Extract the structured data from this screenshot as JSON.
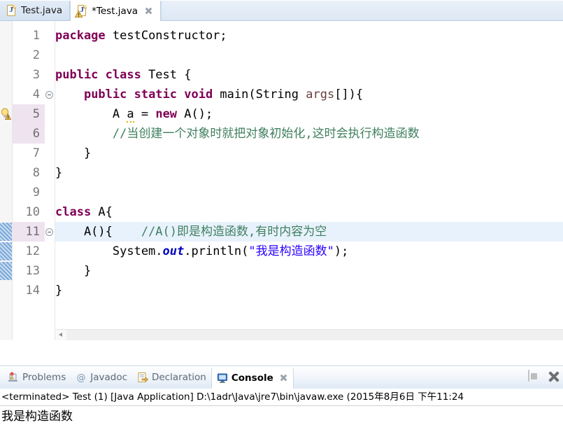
{
  "editor": {
    "tabs": [
      {
        "label": "Test.java",
        "icon": "java-file-icon",
        "active": false,
        "dirty": false,
        "has_warning": false,
        "closable": false
      },
      {
        "label": "*Test.java",
        "icon": "java-file-warning-icon",
        "active": true,
        "dirty": true,
        "has_warning": true,
        "closable": true
      }
    ],
    "close_icon": "close-icon",
    "lines": [
      {
        "num": "1",
        "fold": false,
        "marker": "none",
        "cursor": false,
        "num_hl": false,
        "tokens": [
          {
            "t": "package",
            "c": "kw"
          },
          {
            "t": " testConstructor;",
            "c": "pln"
          }
        ]
      },
      {
        "num": "2",
        "fold": false,
        "marker": "none",
        "cursor": false,
        "num_hl": false,
        "tokens": []
      },
      {
        "num": "3",
        "fold": false,
        "marker": "none",
        "cursor": false,
        "num_hl": false,
        "tokens": [
          {
            "t": "public class",
            "c": "kw"
          },
          {
            "t": " Test {",
            "c": "pln"
          }
        ]
      },
      {
        "num": "4",
        "fold": true,
        "marker": "none",
        "cursor": false,
        "num_hl": false,
        "tokens": [
          {
            "t": "    ",
            "c": "pln"
          },
          {
            "t": "public static void",
            "c": "kw"
          },
          {
            "t": " main(String ",
            "c": "pln"
          },
          {
            "t": "args",
            "c": "par"
          },
          {
            "t": "[]){",
            "c": "pln"
          }
        ]
      },
      {
        "num": "5",
        "fold": false,
        "marker": "warning-bulb",
        "cursor": false,
        "num_hl": true,
        "tokens": [
          {
            "t": "        A ",
            "c": "pln"
          },
          {
            "t": "a",
            "c": "pln warnunder"
          },
          {
            "t": " = ",
            "c": "pln"
          },
          {
            "t": "new",
            "c": "kw"
          },
          {
            "t": " A();",
            "c": "pln"
          }
        ]
      },
      {
        "num": "6",
        "fold": false,
        "marker": "none",
        "cursor": false,
        "num_hl": true,
        "tokens": [
          {
            "t": "        //当创建一个对象时就把对象初始化,这时会执行构造函数",
            "c": "cmt"
          }
        ]
      },
      {
        "num": "7",
        "fold": false,
        "marker": "none",
        "cursor": false,
        "num_hl": false,
        "tokens": [
          {
            "t": "    }",
            "c": "pln"
          }
        ]
      },
      {
        "num": "8",
        "fold": false,
        "marker": "none",
        "cursor": false,
        "num_hl": false,
        "tokens": [
          {
            "t": "}",
            "c": "pln"
          }
        ]
      },
      {
        "num": "9",
        "fold": false,
        "marker": "none",
        "cursor": false,
        "num_hl": false,
        "tokens": []
      },
      {
        "num": "10",
        "fold": false,
        "marker": "none",
        "cursor": false,
        "num_hl": false,
        "tokens": [
          {
            "t": "class",
            "c": "kw"
          },
          {
            "t": " A{",
            "c": "pln"
          }
        ]
      },
      {
        "num": "11",
        "fold": true,
        "marker": "occurrence",
        "cursor": true,
        "num_hl": true,
        "tokens": [
          {
            "t": "    A(){    ",
            "c": "pln"
          },
          {
            "t": "//A()即是构造函数,有时内容为空",
            "c": "cmt"
          }
        ]
      },
      {
        "num": "12",
        "fold": false,
        "marker": "occurrence",
        "cursor": false,
        "num_hl": false,
        "tokens": [
          {
            "t": "        System.",
            "c": "pln"
          },
          {
            "t": "out",
            "c": "fld"
          },
          {
            "t": ".println(",
            "c": "pln"
          },
          {
            "t": "\"我是构造函数\"",
            "c": "str"
          },
          {
            "t": ");",
            "c": "pln"
          }
        ]
      },
      {
        "num": "13",
        "fold": false,
        "marker": "occurrence",
        "cursor": false,
        "num_hl": false,
        "tokens": [
          {
            "t": "    }",
            "c": "pln"
          }
        ]
      },
      {
        "num": "14",
        "fold": false,
        "marker": "none",
        "cursor": false,
        "num_hl": false,
        "tokens": [
          {
            "t": "}",
            "c": "pln"
          }
        ]
      }
    ],
    "hscroll": {
      "left_arrow_icon": "scroll-left-arrow-icon"
    }
  },
  "bottom": {
    "tabs": [
      {
        "label": "Problems",
        "icon": "problems-icon",
        "active": false
      },
      {
        "label": "Javadoc",
        "icon": "javadoc-at-icon",
        "active": false
      },
      {
        "label": "Declaration",
        "icon": "declaration-icon",
        "active": false
      },
      {
        "label": "Console",
        "icon": "console-icon",
        "active": true
      }
    ],
    "close_icon": "close-icon",
    "toolbar": [
      {
        "name": "terminate-button",
        "icon": "stop-square-icon",
        "enabled": false
      },
      {
        "name": "remove-launch-button",
        "icon": "close-icon",
        "enabled": true
      }
    ],
    "console": {
      "header": "<terminated> Test (1) [Java Application] D:\\1adr\\Java\\jre7\\bin\\javaw.exe (2015年8月6日 下午11:24",
      "output": "我是构造函数"
    }
  },
  "colors": {
    "keyword": "#7f0055",
    "comment": "#3f7f5f",
    "string": "#2a00ff",
    "static_field": "#0000c0",
    "parameter": "#6a3e3e",
    "cursor_line": "#e8f2fc",
    "line_number_highlight": "#efe3ef",
    "tab_active_bg": "#ffffff"
  }
}
